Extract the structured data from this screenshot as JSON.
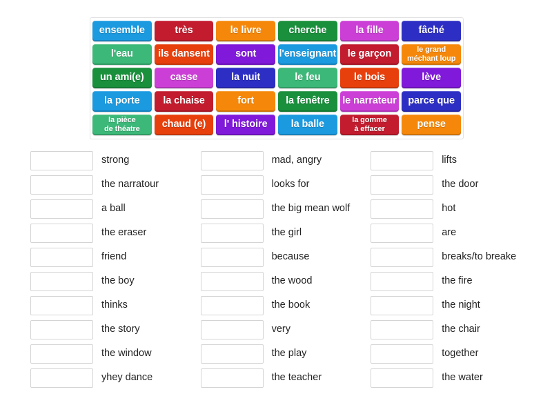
{
  "activity": {
    "type": "match-up-drag-and-drop",
    "language_pair": "French to English"
  },
  "tile_bank": {
    "rows": [
      [
        {
          "label": "ensemble",
          "color": "#1b9ae0",
          "lines": 1
        },
        {
          "label": "très",
          "color": "#c21c2e",
          "lines": 1
        },
        {
          "label": "le livre",
          "color": "#f5880a",
          "lines": 1
        },
        {
          "label": "cherche",
          "color": "#1a8f3c",
          "lines": 1
        },
        {
          "label": "la fille",
          "color": "#cc3fd6",
          "lines": 1
        },
        {
          "label": "fâché",
          "color": "#2d2fc4",
          "lines": 1
        }
      ],
      [
        {
          "label": "l'eau",
          "color": "#3cb878",
          "lines": 1
        },
        {
          "label": "ils dansent",
          "color": "#e8400c",
          "lines": 1
        },
        {
          "label": "sont",
          "color": "#8019d9",
          "lines": 1
        },
        {
          "label": "l'enseignant",
          "color": "#1b9ae0",
          "lines": 1
        },
        {
          "label": "le garçon",
          "color": "#c21c2e",
          "lines": 1
        },
        {
          "label": "le grand\nméchant loup",
          "color": "#f5880a",
          "lines": 2
        }
      ],
      [
        {
          "label": "un ami(e)",
          "color": "#1a8f3c",
          "lines": 1
        },
        {
          "label": "casse",
          "color": "#cc3fd6",
          "lines": 1
        },
        {
          "label": "la nuit",
          "color": "#2d2fc4",
          "lines": 1
        },
        {
          "label": "le feu",
          "color": "#3cb878",
          "lines": 1
        },
        {
          "label": "le bois",
          "color": "#e8400c",
          "lines": 1
        },
        {
          "label": "lève",
          "color": "#8019d9",
          "lines": 1
        }
      ],
      [
        {
          "label": "la porte",
          "color": "#1b9ae0",
          "lines": 1
        },
        {
          "label": "la chaise",
          "color": "#c21c2e",
          "lines": 1
        },
        {
          "label": "fort",
          "color": "#f5880a",
          "lines": 1
        },
        {
          "label": "la fenêtre",
          "color": "#1a8f3c",
          "lines": 1
        },
        {
          "label": "le narrateur",
          "color": "#cc3fd6",
          "lines": 1
        },
        {
          "label": "parce que",
          "color": "#2d2fc4",
          "lines": 1
        }
      ],
      [
        {
          "label": "la pièce\nde théatre",
          "color": "#3cb878",
          "lines": 2
        },
        {
          "label": "chaud (e)",
          "color": "#e8400c",
          "lines": 1
        },
        {
          "label": "l' histoire",
          "color": "#8019d9",
          "lines": 1
        },
        {
          "label": "la balle",
          "color": "#1b9ae0",
          "lines": 1
        },
        {
          "label": "la gomme\nà effacer",
          "color": "#c21c2e",
          "lines": 2
        },
        {
          "label": "pense",
          "color": "#f5880a",
          "lines": 1
        }
      ]
    ]
  },
  "answers": {
    "columns": [
      {
        "items": [
          {
            "text": "strong",
            "slot_value": ""
          },
          {
            "text": "the narratour",
            "slot_value": ""
          },
          {
            "text": "a ball",
            "slot_value": ""
          },
          {
            "text": "the eraser",
            "slot_value": ""
          },
          {
            "text": "friend",
            "slot_value": ""
          },
          {
            "text": "the boy",
            "slot_value": ""
          },
          {
            "text": "thinks",
            "slot_value": ""
          },
          {
            "text": "the story",
            "slot_value": ""
          },
          {
            "text": "the window",
            "slot_value": ""
          },
          {
            "text": "yhey dance",
            "slot_value": ""
          }
        ]
      },
      {
        "items": [
          {
            "text": "mad, angry",
            "slot_value": ""
          },
          {
            "text": "looks for",
            "slot_value": ""
          },
          {
            "text": "the big mean wolf",
            "slot_value": ""
          },
          {
            "text": "the girl",
            "slot_value": ""
          },
          {
            "text": "because",
            "slot_value": ""
          },
          {
            "text": "the wood",
            "slot_value": ""
          },
          {
            "text": "the book",
            "slot_value": ""
          },
          {
            "text": "very",
            "slot_value": ""
          },
          {
            "text": "the play",
            "slot_value": ""
          },
          {
            "text": "the teacher",
            "slot_value": ""
          }
        ]
      },
      {
        "items": [
          {
            "text": "lifts",
            "slot_value": ""
          },
          {
            "text": "the door",
            "slot_value": ""
          },
          {
            "text": "hot",
            "slot_value": ""
          },
          {
            "text": "are",
            "slot_value": ""
          },
          {
            "text": "breaks/to breake",
            "slot_value": ""
          },
          {
            "text": "the fire",
            "slot_value": ""
          },
          {
            "text": "the night",
            "slot_value": ""
          },
          {
            "text": "the chair",
            "slot_value": ""
          },
          {
            "text": "together",
            "slot_value": ""
          },
          {
            "text": "the water",
            "slot_value": ""
          }
        ]
      }
    ]
  },
  "colors": {
    "blue": "#1b9ae0",
    "red": "#c21c2e",
    "orange": "#f5880a",
    "green_dark": "#1a8f3c",
    "magenta": "#cc3fd6",
    "indigo": "#2d2fc4",
    "green_light": "#3cb878",
    "orange_red": "#e8400c",
    "purple": "#8019d9",
    "slot_border": "#d4d4d4",
    "bank_border": "#e2e2e2",
    "text": "#222222",
    "background": "#ffffff"
  }
}
